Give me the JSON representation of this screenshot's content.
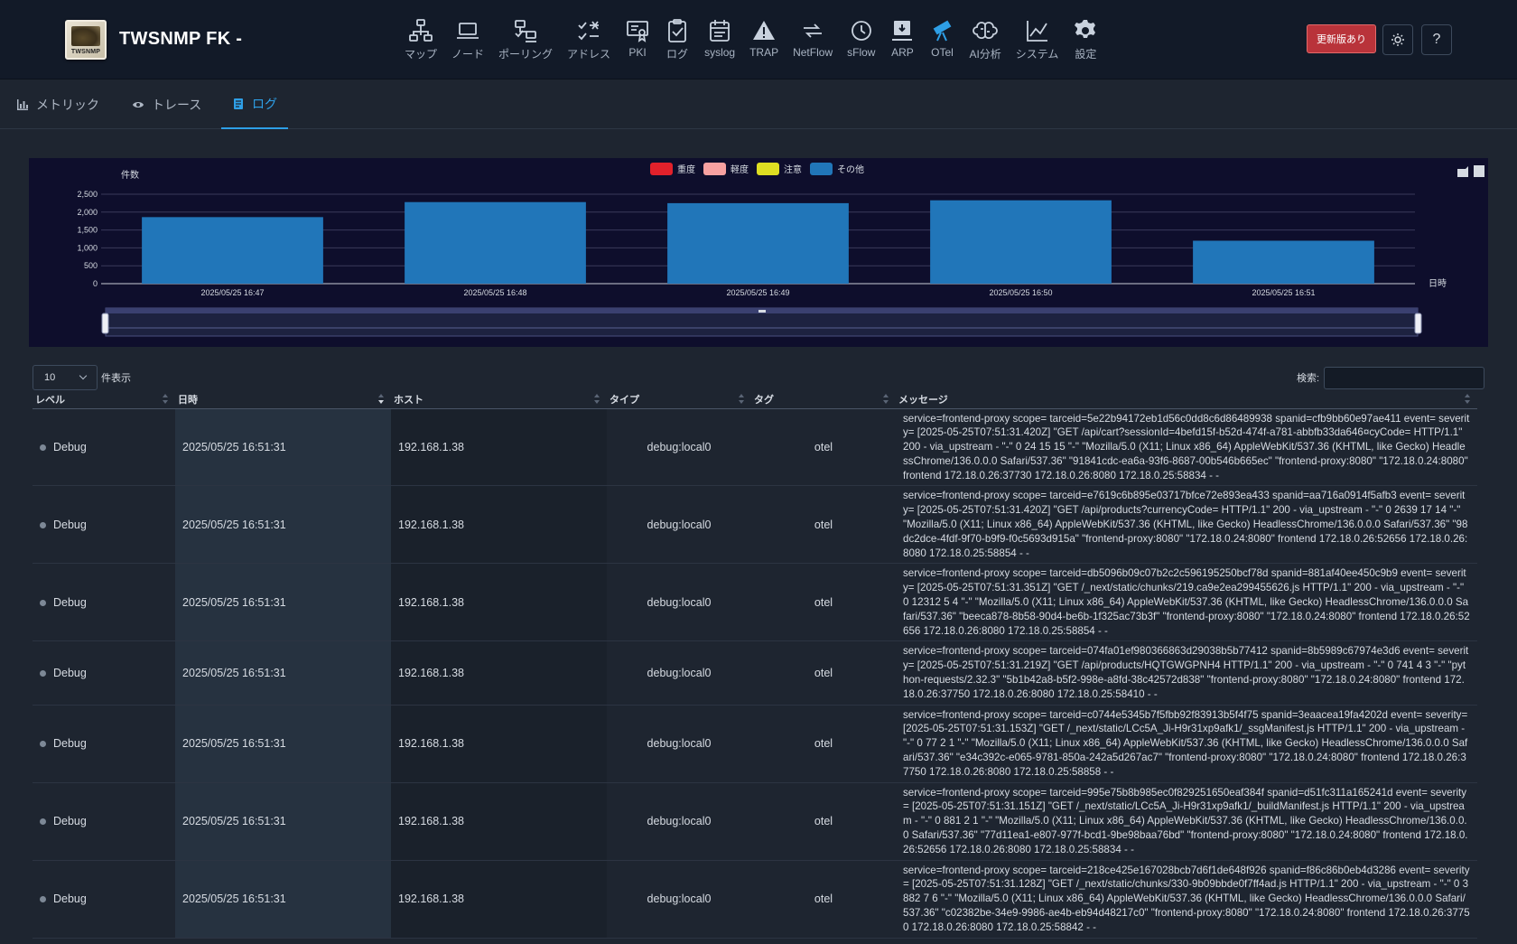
{
  "app": {
    "title": "TWSNMP FK -",
    "logo_text": "TWSNMP"
  },
  "nav": [
    {
      "label": "マップ",
      "icon": "map-icon"
    },
    {
      "label": "ノード",
      "icon": "laptop-icon"
    },
    {
      "label": "ポーリング",
      "icon": "polling-icon"
    },
    {
      "label": "アドレス",
      "icon": "address-check-icon"
    },
    {
      "label": "PKI",
      "icon": "certificate-icon"
    },
    {
      "label": "ログ",
      "icon": "clipboard-check-icon"
    },
    {
      "label": "syslog",
      "icon": "calendar-text-icon"
    },
    {
      "label": "TRAP",
      "icon": "alert-triangle-icon"
    },
    {
      "label": "NetFlow",
      "icon": "arrows-flow-icon"
    },
    {
      "label": "sFlow",
      "icon": "clock-history-icon"
    },
    {
      "label": "ARP",
      "icon": "monitor-download-icon"
    },
    {
      "label": "OTel",
      "icon": "telescope-icon"
    },
    {
      "label": "AI分析",
      "icon": "brain-icon"
    },
    {
      "label": "システム",
      "icon": "line-chart-icon"
    },
    {
      "label": "設定",
      "icon": "gear-icon"
    }
  ],
  "header_buttons": {
    "update": "更新版あり",
    "help": "?"
  },
  "colors": {
    "accent": "#2e9fe6",
    "update_button": "#b9333a",
    "bar": "#2176b9"
  },
  "tabs": [
    {
      "label": "メトリック",
      "icon": "bar-chart-icon",
      "active": false
    },
    {
      "label": "トレース",
      "icon": "eye-icon",
      "active": false
    },
    {
      "label": "ログ",
      "icon": "document-icon",
      "active": true
    }
  ],
  "chart_data": {
    "type": "bar",
    "categories": [
      "2025/05/25 16:47",
      "2025/05/25 16:48",
      "2025/05/25 16:49",
      "2025/05/25 16:50",
      "2025/05/25 16:51"
    ],
    "series": [
      {
        "name": "重度",
        "color": "#e2212b",
        "values": [
          0,
          0,
          0,
          0,
          0
        ]
      },
      {
        "name": "軽度",
        "color": "#f7a1a1",
        "values": [
          0,
          0,
          0,
          0,
          0
        ]
      },
      {
        "name": "注意",
        "color": "#dede22",
        "values": [
          0,
          0,
          0,
          0,
          0
        ]
      },
      {
        "name": "その他",
        "color": "#2176b9",
        "values": [
          1860,
          2280,
          2250,
          2330,
          1200
        ]
      }
    ],
    "ylabel": "件数",
    "xlabel": "日時",
    "yticks": [
      0,
      500,
      1000,
      1500,
      2000,
      2500
    ],
    "ylim": [
      0,
      2500
    ],
    "grid": true,
    "legend": "top-center",
    "datazoom": true
  },
  "table": {
    "length_value": "10",
    "length_label": "件表示",
    "search_label": "検索:",
    "search_value": "",
    "columns": [
      "レベル",
      "日時",
      "ホスト",
      "タイプ",
      "タグ",
      "メッセージ"
    ],
    "rows": [
      {
        "level": "Debug",
        "time": "2025/05/25 16:51:31",
        "host": "192.168.1.38",
        "type": "debug:local0",
        "tag": "otel",
        "message": "service=frontend-proxy scope= tarceid=5e22b94172eb1d56c0dd8c6d86489938 spanid=cfb9bb60e97ae411 event= severity= [2025-05-25T07:51:31.420Z] \"GET /api/cart?sessionId=4befd15f-b52d-474f-a781-abbfb33da646¤cyCode= HTTP/1.1\" 200 - via_upstream - \"-\" 0 24 15 15 \"-\" \"Mozilla/5.0 (X11; Linux x86_64) AppleWebKit/537.36 (KHTML, like Gecko) HeadlessChrome/136.0.0.0 Safari/537.36\" \"91841cdc-ea6a-93f6-8687-00b546b665ec\" \"frontend-proxy:8080\" \"172.18.0.24:8080\" frontend 172.18.0.26:37730 172.18.0.26:8080 172.18.0.25:58834 - -"
      },
      {
        "level": "Debug",
        "time": "2025/05/25 16:51:31",
        "host": "192.168.1.38",
        "type": "debug:local0",
        "tag": "otel",
        "message": "service=frontend-proxy scope= tarceid=e7619c6b895e03717bfce72e893ea433 spanid=aa716a0914f5afb3 event= severity= [2025-05-25T07:51:31.420Z] \"GET /api/products?currencyCode= HTTP/1.1\" 200 - via_upstream - \"-\" 0 2639 17 14 \"-\" \"Mozilla/5.0 (X11; Linux x86_64) AppleWebKit/537.36 (KHTML, like Gecko) HeadlessChrome/136.0.0.0 Safari/537.36\" \"98dc2dce-4fdf-9f70-b9f9-f0c5693d915a\" \"frontend-proxy:8080\" \"172.18.0.24:8080\" frontend 172.18.0.26:52656 172.18.0.26:8080 172.18.0.25:58854 - -"
      },
      {
        "level": "Debug",
        "time": "2025/05/25 16:51:31",
        "host": "192.168.1.38",
        "type": "debug:local0",
        "tag": "otel",
        "message": "service=frontend-proxy scope= tarceid=db5096b09c07b2c2c596195250bcf78d spanid=881af40ee450c9b9 event= severity= [2025-05-25T07:51:31.351Z] \"GET /_next/static/chunks/219.ca9e2ea299455626.js HTTP/1.1\" 200 - via_upstream - \"-\" 0 12312 5 4 \"-\" \"Mozilla/5.0 (X11; Linux x86_64) AppleWebKit/537.36 (KHTML, like Gecko) HeadlessChrome/136.0.0.0 Safari/537.36\" \"beeca878-8b58-90d4-be6b-1f325ac73b3f\" \"frontend-proxy:8080\" \"172.18.0.24:8080\" frontend 172.18.0.26:52656 172.18.0.26:8080 172.18.0.25:58854 - -"
      },
      {
        "level": "Debug",
        "time": "2025/05/25 16:51:31",
        "host": "192.168.1.38",
        "type": "debug:local0",
        "tag": "otel",
        "message": "service=frontend-proxy scope= tarceid=074fa01ef980366863d29038b5b77412 spanid=8b5989c67974e3d6 event= severity= [2025-05-25T07:51:31.219Z] \"GET /api/products/HQTGWGPNH4 HTTP/1.1\" 200 - via_upstream - \"-\" 0 741 4 3 \"-\" \"python-requests/2.32.3\" \"5b1b42a8-b5f2-998e-a8fd-38c42572d838\" \"frontend-proxy:8080\" \"172.18.0.24:8080\" frontend 172.18.0.26:37750 172.18.0.26:8080 172.18.0.25:58410 - -"
      },
      {
        "level": "Debug",
        "time": "2025/05/25 16:51:31",
        "host": "192.168.1.38",
        "type": "debug:local0",
        "tag": "otel",
        "message": "service=frontend-proxy scope= tarceid=c0744e5345b7f5fbb92f83913b5f4f75 spanid=3eaacea19fa4202d event= severity= [2025-05-25T07:51:31.153Z] \"GET /_next/static/LCc5A_Ji-H9r31xp9afk1/_ssgManifest.js HTTP/1.1\" 200 - via_upstream - \"-\" 0 77 2 1 \"-\" \"Mozilla/5.0 (X11; Linux x86_64) AppleWebKit/537.36 (KHTML, like Gecko) HeadlessChrome/136.0.0.0 Safari/537.36\" \"e34c392c-e065-9781-850a-242a5d267ac7\" \"frontend-proxy:8080\" \"172.18.0.24:8080\" frontend 172.18.0.26:37750 172.18.0.26:8080 172.18.0.25:58858 - -"
      },
      {
        "level": "Debug",
        "time": "2025/05/25 16:51:31",
        "host": "192.168.1.38",
        "type": "debug:local0",
        "tag": "otel",
        "message": "service=frontend-proxy scope= tarceid=995e75b8b985ec0f829251650eaf384f spanid=d51fc311a165241d event= severity= [2025-05-25T07:51:31.151Z] \"GET /_next/static/LCc5A_Ji-H9r31xp9afk1/_buildManifest.js HTTP/1.1\" 200 - via_upstream - \"-\" 0 881 2 1 \"-\" \"Mozilla/5.0 (X11; Linux x86_64) AppleWebKit/537.36 (KHTML, like Gecko) HeadlessChrome/136.0.0.0 Safari/537.36\" \"77d11ea1-e807-977f-bcd1-9be98baa76bd\" \"frontend-proxy:8080\" \"172.18.0.24:8080\" frontend 172.18.0.26:52656 172.18.0.26:8080 172.18.0.25:58834 - -"
      },
      {
        "level": "Debug",
        "time": "2025/05/25 16:51:31",
        "host": "192.168.1.38",
        "type": "debug:local0",
        "tag": "otel",
        "message": "service=frontend-proxy scope= tarceid=218ce425e167028bcb7d6f1de648f926 spanid=f86c86b0eb4d3286 event= severity= [2025-05-25T07:51:31.128Z] \"GET /_next/static/chunks/330-9b09bbde0f7ff4ad.js HTTP/1.1\" 200 - via_upstream - \"-\" 0 3882 7 6 \"-\" \"Mozilla/5.0 (X11; Linux x86_64) AppleWebKit/537.36 (KHTML, like Gecko) HeadlessChrome/136.0.0.0 Safari/537.36\" \"c02382be-34e9-9986-ae4b-eb94d48217c0\" \"frontend-proxy:8080\" \"172.18.0.24:8080\" frontend 172.18.0.26:37750 172.18.0.26:8080 172.18.0.25:58842 - -"
      }
    ]
  }
}
